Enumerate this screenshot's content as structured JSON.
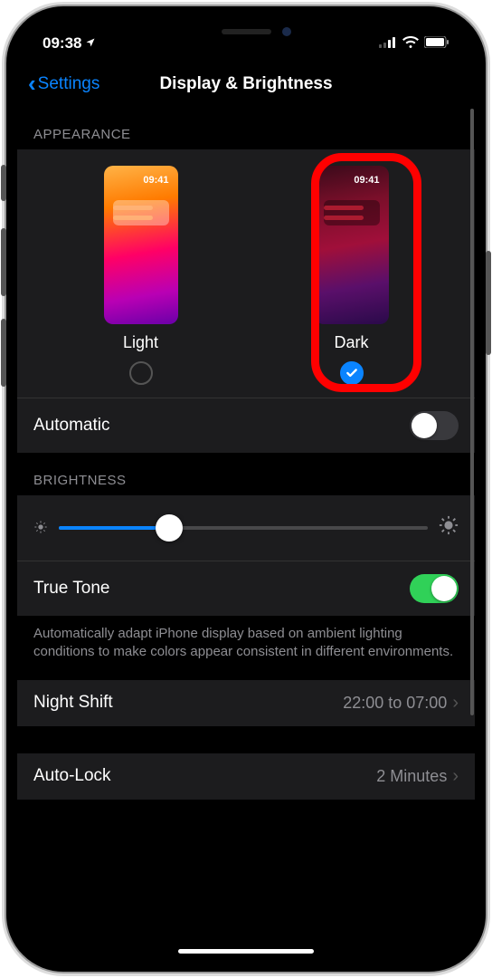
{
  "status": {
    "time": "09:38",
    "location_icon": "➤"
  },
  "nav": {
    "back_label": "Settings",
    "title": "Display & Brightness"
  },
  "appearance": {
    "header": "APPEARANCE",
    "thumb_time": "09:41",
    "light_label": "Light",
    "dark_label": "Dark",
    "selected": "dark",
    "automatic_label": "Automatic",
    "automatic_on": false,
    "highlight": "dark"
  },
  "brightness": {
    "header": "BRIGHTNESS",
    "value_percent": 30,
    "truetone_label": "True Tone",
    "truetone_on": true,
    "truetone_footer": "Automatically adapt iPhone display based on ambient lighting conditions to make colors appear consistent in different environments."
  },
  "night_shift": {
    "label": "Night Shift",
    "value": "22:00 to 07:00"
  },
  "auto_lock": {
    "label": "Auto-Lock",
    "value": "2 Minutes"
  }
}
